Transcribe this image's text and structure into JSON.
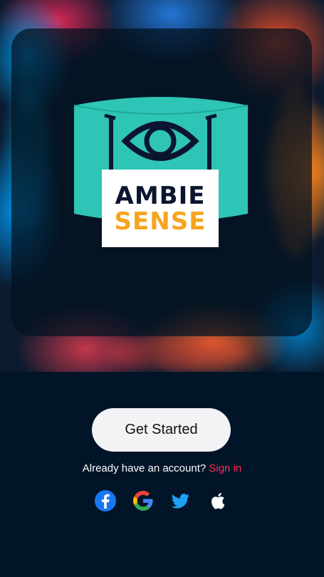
{
  "logo": {
    "line1": "AMBIE",
    "line2": "SENSE"
  },
  "cta": {
    "label": "Get Started"
  },
  "signin": {
    "prompt": "Already have an account?",
    "link": "Sign in"
  },
  "social": [
    {
      "name": "facebook-icon",
      "color": "#1877f2"
    },
    {
      "name": "google-icon",
      "color": "#4285f4"
    },
    {
      "name": "twitter-icon",
      "color": "#1da1f2"
    },
    {
      "name": "apple-icon",
      "color": "#ffffff"
    }
  ],
  "colors": {
    "background": "#011428",
    "logo_teal": "#2ec4b6",
    "logo_navy": "#0b1530",
    "logo_orange": "#f7a41d",
    "link": "#ff2d55"
  }
}
